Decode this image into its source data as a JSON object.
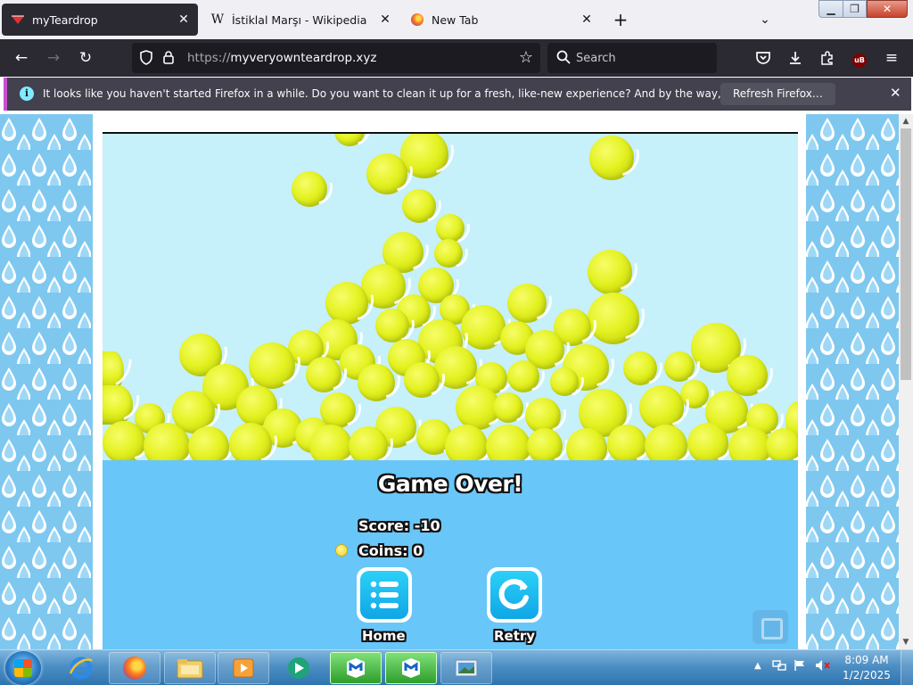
{
  "browser": {
    "tabs": [
      {
        "label": "myTeardrop",
        "favicon": "teardrop-favicon-icon",
        "active": true
      },
      {
        "label": "İstiklal Marşı - Wikipedia",
        "favicon": "wikipedia-icon",
        "active": false
      },
      {
        "label": "New Tab",
        "favicon": "firefox-icon",
        "active": false
      }
    ],
    "url": {
      "protocol": "https://",
      "host": "myveryownteardrop.xyz"
    },
    "search_placeholder": "Search",
    "ublock_badge": "uB"
  },
  "notification": {
    "text": "It looks like you haven't started Firefox in a while. Do you want to clean it up for a fresh, like-new experience? And by the way, welcome back!",
    "button_label": "Refresh Firefox…"
  },
  "game": {
    "title": "Game Over!",
    "score_text": "Score: -10",
    "coins_text": "Coins: 0",
    "home_label": "Home",
    "retry_label": "Retry"
  },
  "taskbar": {
    "time": "8:09 AM",
    "date": "1/2/2025"
  },
  "colors": {
    "playfield_bg": "#c6f0fa",
    "panel_bg": "#69c6f8",
    "ball": "#e4f222",
    "browser_dark": "#2b2a33",
    "notification_accent": "#c94dd0"
  }
}
